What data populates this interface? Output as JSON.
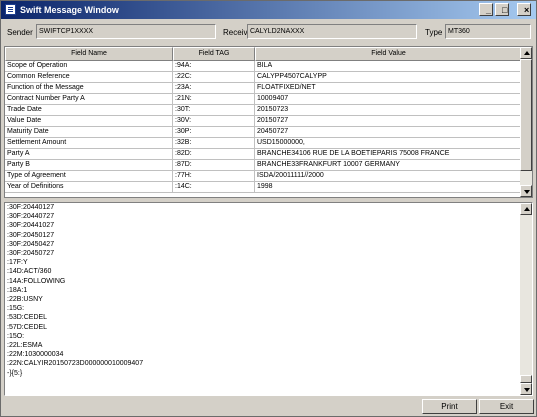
{
  "window": {
    "title": "Swift Message Window",
    "minimize": "_",
    "maximize": "□",
    "close": "×"
  },
  "header": {
    "sender_label": "Sender",
    "sender_value": "SWIFTCP1XXXX",
    "receiver_label": "Receiver",
    "receiver_value": "CALYLD2NAXXX",
    "type_label": "Type",
    "type_value": "MT360"
  },
  "table": {
    "columns": [
      "Field Name",
      "Field TAG",
      "Field Value"
    ],
    "rows": [
      [
        "Scope of Operation",
        ":94A:",
        "BILA"
      ],
      [
        "Common Reference",
        ":22C:",
        "CALYPP4507CALYPP"
      ],
      [
        "Function of the Message",
        ":23A:",
        "FLOATFIXED/NET"
      ],
      [
        "Contract Number Party A",
        ":21N:",
        "10009407"
      ],
      [
        "Trade Date",
        ":30T:",
        "20150723"
      ],
      [
        "Value Date",
        ":30V:",
        "20150727"
      ],
      [
        "Maturity Date",
        ":30P:",
        "20450727"
      ],
      [
        "Settlement Amount",
        ":32B:",
        "USD15000000,"
      ],
      [
        "Party A",
        ":82D:",
        "BRANCHE34106 RUE DE LA BOETIEPARIS 75008  FRANCE"
      ],
      [
        "Party B",
        ":87D:",
        "BRANCHE33FRANKFURT 10007  GERMANY"
      ],
      [
        "Type of Agreement",
        ":77H:",
        "ISDA/20011111//2000"
      ],
      [
        "Year of Definitions",
        ":14C:",
        "1998"
      ]
    ]
  },
  "message_text": [
    ":30F:20440127",
    ":30F:20440727",
    ":30F:20441027",
    ":30F:20450127",
    ":30F:20450427",
    ":30F:20450727",
    ":17F:Y",
    ":14D:ACT/360",
    ":14A:FOLLOWING",
    ":18A:1",
    ":22B:USNY",
    ":15G:",
    ":53D:CEDEL",
    ":57D:CEDEL",
    ":15O:",
    ":22L:ESMA",
    ":22M:1030000034",
    ":22N:CALYIR20150723D000000010009407",
    "-}{5:}"
  ],
  "buttons": {
    "print": "Print",
    "exit": "Exit"
  }
}
